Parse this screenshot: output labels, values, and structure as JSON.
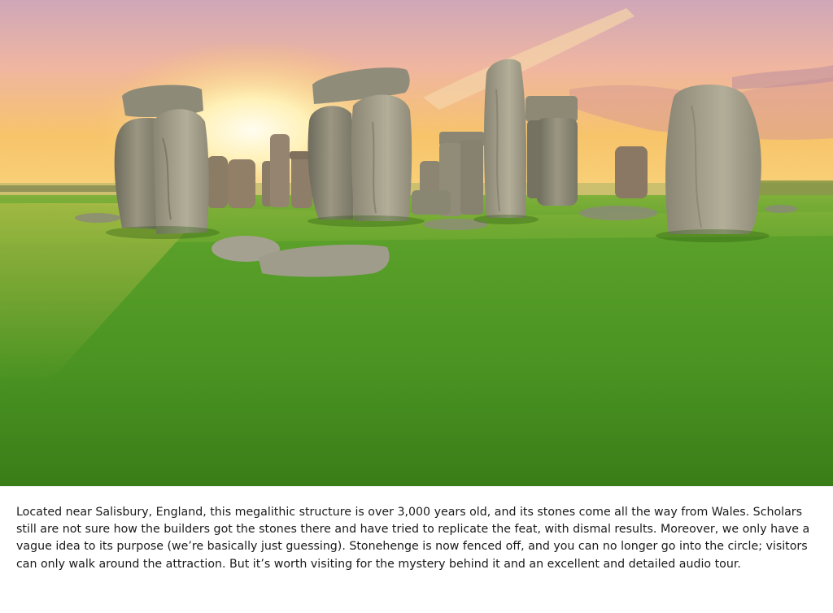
{
  "photo": {
    "subject": "stonehenge-at-sunset",
    "colors": {
      "sky_top": "#c9a3b4",
      "sky_glow": "#f7c96a",
      "sun": "#fffbe6",
      "grass": "#4f9a25",
      "grass_dark": "#2f6e14",
      "stone": "#8e8a7a",
      "stone_dark": "#5c5a4c"
    }
  },
  "caption": {
    "text": "Located near Salisbury, England, this megalithic structure is over 3,000 years old, and its stones come all the way from Wales. Scholars still are not sure how the builders got the stones there and have tried to replicate the feat, with dismal results. Moreover, we only have a vague idea to its purpose (we’re basically just guessing). Stonehenge is now fenced off, and you can no longer go into the circle; visitors can only walk around the attraction. But it’s worth visiting for the mystery behind it and an excellent and detailed audio tour."
  }
}
